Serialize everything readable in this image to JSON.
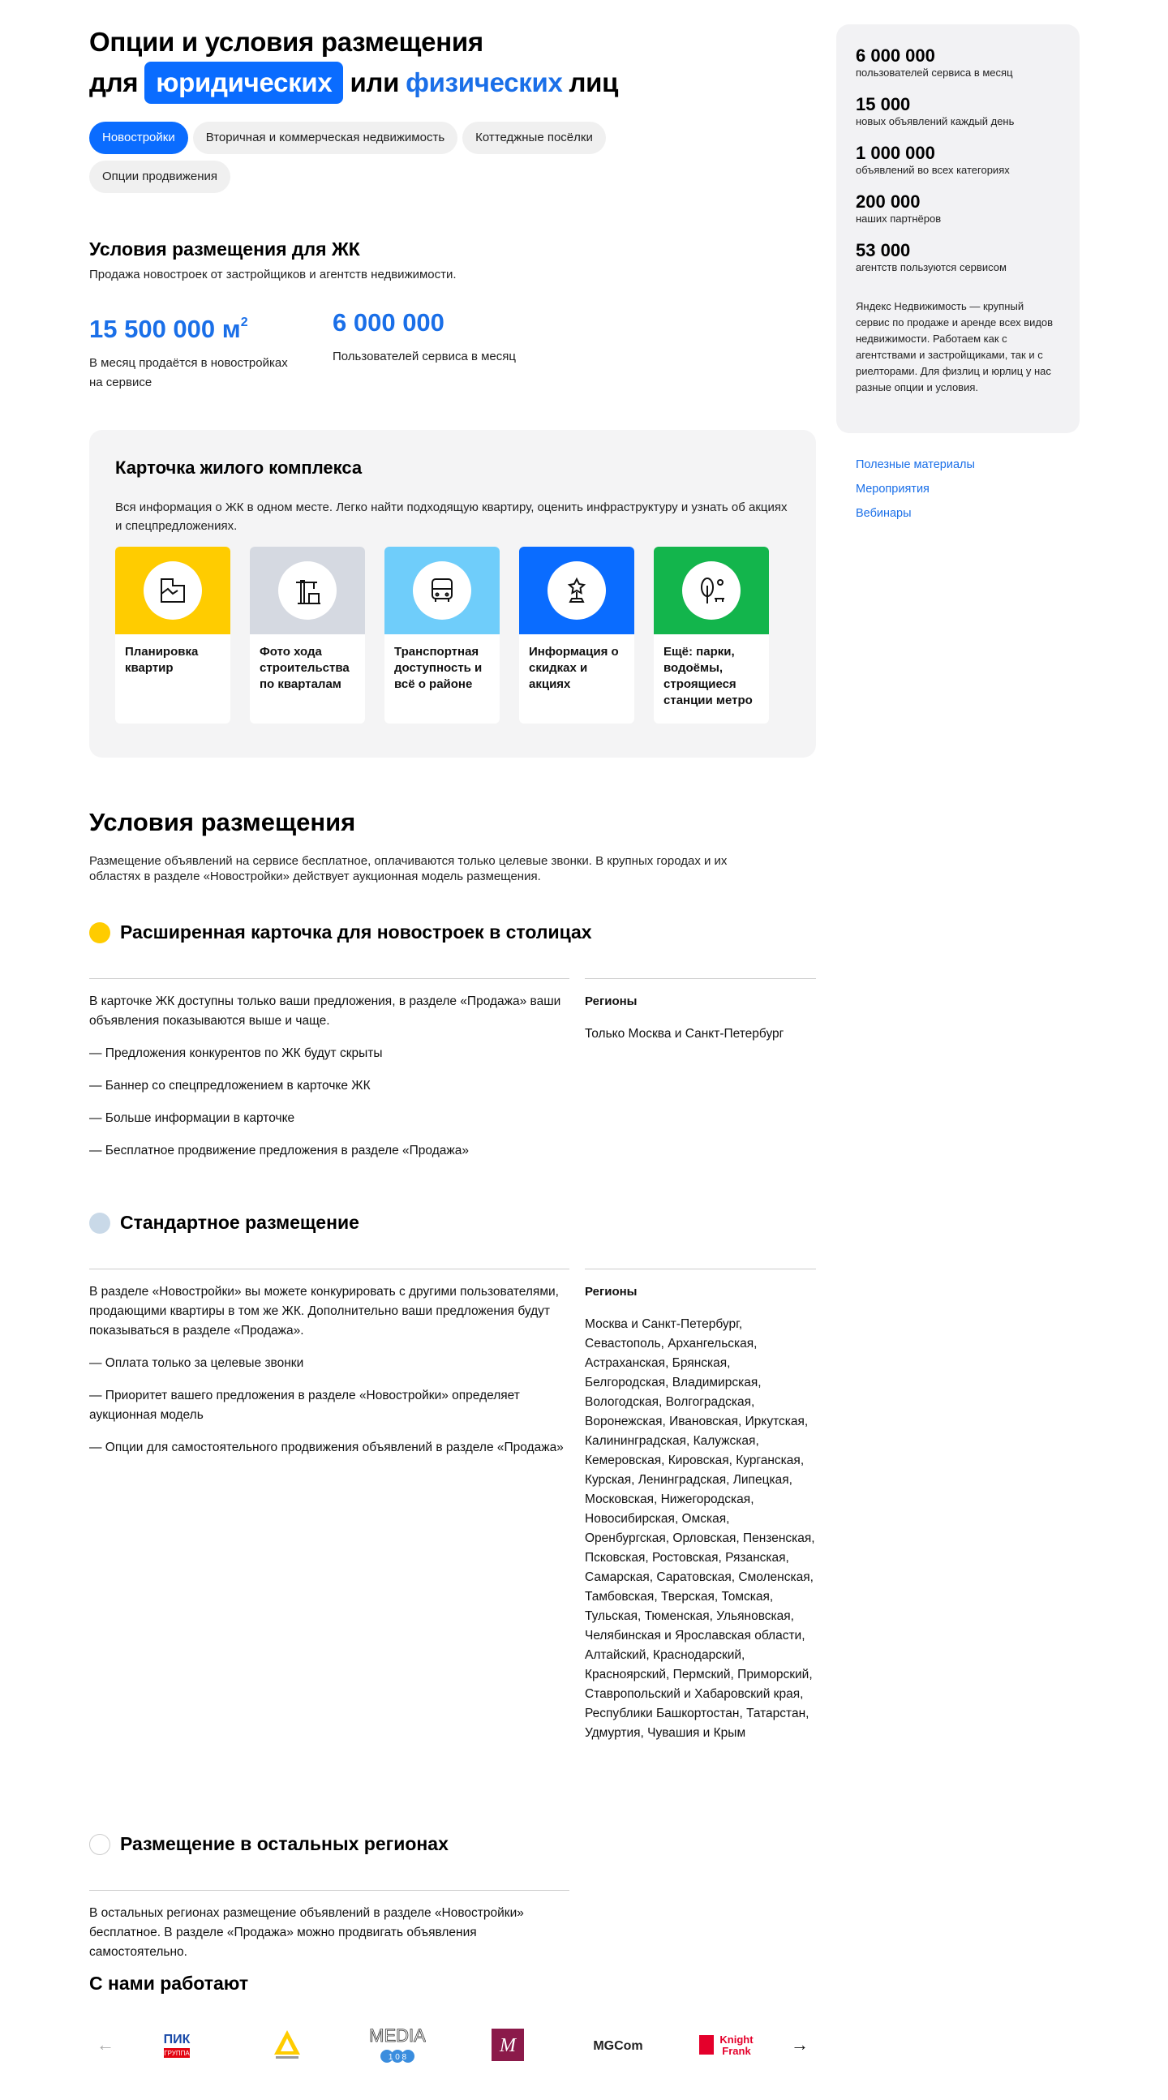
{
  "header": {
    "title_line1": "Опции и условия размещения",
    "for_word": "для",
    "legal_pill": "юридических",
    "or_word": "или",
    "physical_link": "физических",
    "persons_word": "лиц"
  },
  "tabs": [
    "Новостройки",
    "Вторичная и коммерческая недвижимость",
    "Коттеджные посёлки",
    "Опции продвижения"
  ],
  "conditions": {
    "title": "Условия размещения для ЖК",
    "subtitle": "Продажа новостроек от застройщиков и агентств недвижимости.",
    "stats": [
      {
        "value": "15 500 000 м",
        "sup": "2",
        "caption": "В месяц продаётся в новостройках на сервисе"
      },
      {
        "value": "6 000 000",
        "sup": "",
        "caption": "Пользователей сервиса в месяц"
      }
    ]
  },
  "rc_card": {
    "title": "Карточка жилого комплекса",
    "description": "Вся информация о ЖК в одном месте. Легко найти подходящую квартиру, оценить инфраструктуру и узнать об акциях и спецпредложениях.",
    "features": [
      {
        "label": "Планировка квартир",
        "color": "#ffcc00",
        "icon": "floor-plan-icon"
      },
      {
        "label": "Фото хода строительства по кварталам",
        "color": "#d5d9e1",
        "icon": "crane-icon"
      },
      {
        "label": "Транспортная доступность и всё о районе",
        "color": "#6fcdfa",
        "icon": "bus-icon"
      },
      {
        "label": "Информация о скидках и акциях",
        "color": "#0a6cff",
        "icon": "trophy-icon"
      },
      {
        "label": "Ещё: парки, водоёмы, строящиеся станции метро",
        "color": "#13b54c",
        "icon": "tree-icon"
      }
    ]
  },
  "placement": {
    "title": "Условия размещения",
    "description": "Размещение объявлений на сервисе бесплатное, оплачиваются только целевые звонки. В крупных городах и их областях в разделе «Новостройки» действует аукционная модель размещения.",
    "regions_label": "Регионы",
    "plans": [
      {
        "title": "Расширенная карточка для новостроек в столицах",
        "paragraphs": [
          "В карточке ЖК доступны только ваши предложения, в разделе «Продажа» ваши объявления показываются выше и чаще.",
          "— Предложения конкурентов по ЖК будут скрыты",
          "— Баннер со спецпредложением в карточке ЖК",
          "— Больше информации в карточке",
          "— Бесплатное продвижение предложения в разделе «Продажа»"
        ],
        "regions": "Только Москва и Санкт-Петербург"
      },
      {
        "title": "Стандартное размещение",
        "paragraphs": [
          "В разделе «Новостройки» вы можете конкурировать с другими пользователями, продающими квартиры в том же ЖК. Дополнительно ваши предложения будут показываться в разделе «Продажа».",
          "— Оплата только за целевые звонки",
          "— Приоритет вашего предложения в разделе «Новостройки» определяет аукционная модель",
          "— Опции для самостоятельного продвижения объявлений в разделе «Продажа»"
        ],
        "regions": "Москва и Санкт-Петербург, Севастополь, Архангельская, Астраханская, Брянская, Белгородская, Владимирская, Вологодская, Волгоградская, Воронежская, Ивановская, Иркутская, Калининградская, Калужская, Кемеровская, Кировская, Курганская, Курская, Ленинградская, Липецкая, Московская, Нижегородская, Новосибирская, Омская, Оренбургская, Орловская, Пензенская, Псковская, Ростовская, Рязанская, Самарская, Саратовская, Смоленская, Тамбовская, Тверская, Томская, Тульская, Тюменская, Ульяновская, Челябинская и Ярославская области, Алтайский, Краснодарский, Красноярский, Пермский, Приморский, Ставропольский и Хабаровский края, Республики Башкортостан, Татарстан, Удмуртия, Чувашия и Крым"
      },
      {
        "title": "Размещение в остальных регионах",
        "paragraphs": [
          "В остальных регионах размещение объявлений в разделе «Новостройки» бесплатное. В разделе «Продажа» можно продвигать объявления самостоятельно."
        ],
        "regions": ""
      }
    ]
  },
  "partners": {
    "title": "С нами работают",
    "logos": [
      {
        "name": "pik-logo",
        "text": "ПИК",
        "sub": "ГРУППА"
      },
      {
        "name": "yellow-house-logo",
        "text": "",
        "sub": ""
      },
      {
        "name": "media-108-logo",
        "text": "MEDIA",
        "sub": "1 0 8"
      },
      {
        "name": "m-logo",
        "text": "M",
        "sub": ""
      },
      {
        "name": "mgcom-logo",
        "text": "MGCom",
        "sub": ""
      },
      {
        "name": "knight-frank-logo",
        "text": "Knight",
        "sub": "Frank"
      }
    ]
  },
  "sidebar": {
    "stats": [
      {
        "value": "6 000 000",
        "caption": "пользователей сервиса в месяц"
      },
      {
        "value": "15 000",
        "caption": "новых объявлений каждый день"
      },
      {
        "value": "1 000 000",
        "caption": "объявлений во всех категориях"
      },
      {
        "value": "200 000",
        "caption": "наших партнёров"
      },
      {
        "value": "53 000",
        "caption": "агентств пользуются сервисом"
      }
    ],
    "about": "Яндекс Недвижимость — крупный сервис по продаже и аренде всех видов недвижимости. Работаем как с агентствами и застройщиками, так и с риелторами. Для физлиц и юрлиц у нас разные опции и условия.",
    "links": [
      "Полезные материалы",
      "Мероприятия",
      "Вебинары"
    ]
  },
  "colors": {
    "accent": "#0a6cff",
    "link": "#1a6fe8",
    "card_bg": "#f4f4f5"
  }
}
